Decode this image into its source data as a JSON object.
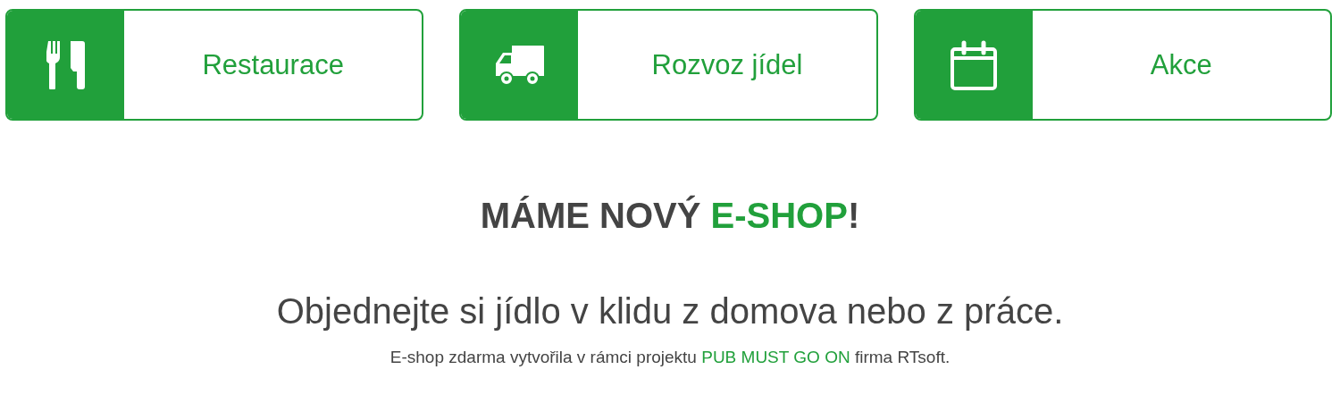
{
  "tiles": [
    {
      "kind": "cutlery",
      "label": "Restaurace"
    },
    {
      "kind": "truck",
      "label": "Rozvoz jídel"
    },
    {
      "kind": "calendar",
      "label": "Akce"
    }
  ],
  "headline": [
    {
      "text": "MÁME NOVÝ ",
      "highlight": false
    },
    {
      "text": "E-SHOP",
      "highlight": true
    },
    {
      "text": "!",
      "highlight": false
    }
  ],
  "subtitle": "Objednejte si jídlo v klidu z domova nebo z práce.",
  "footer": {
    "before": "E-shop zdarma vytvořila v rámci projektu ",
    "link": "PUB MUST GO ON",
    "after": " firma RTsoft."
  }
}
